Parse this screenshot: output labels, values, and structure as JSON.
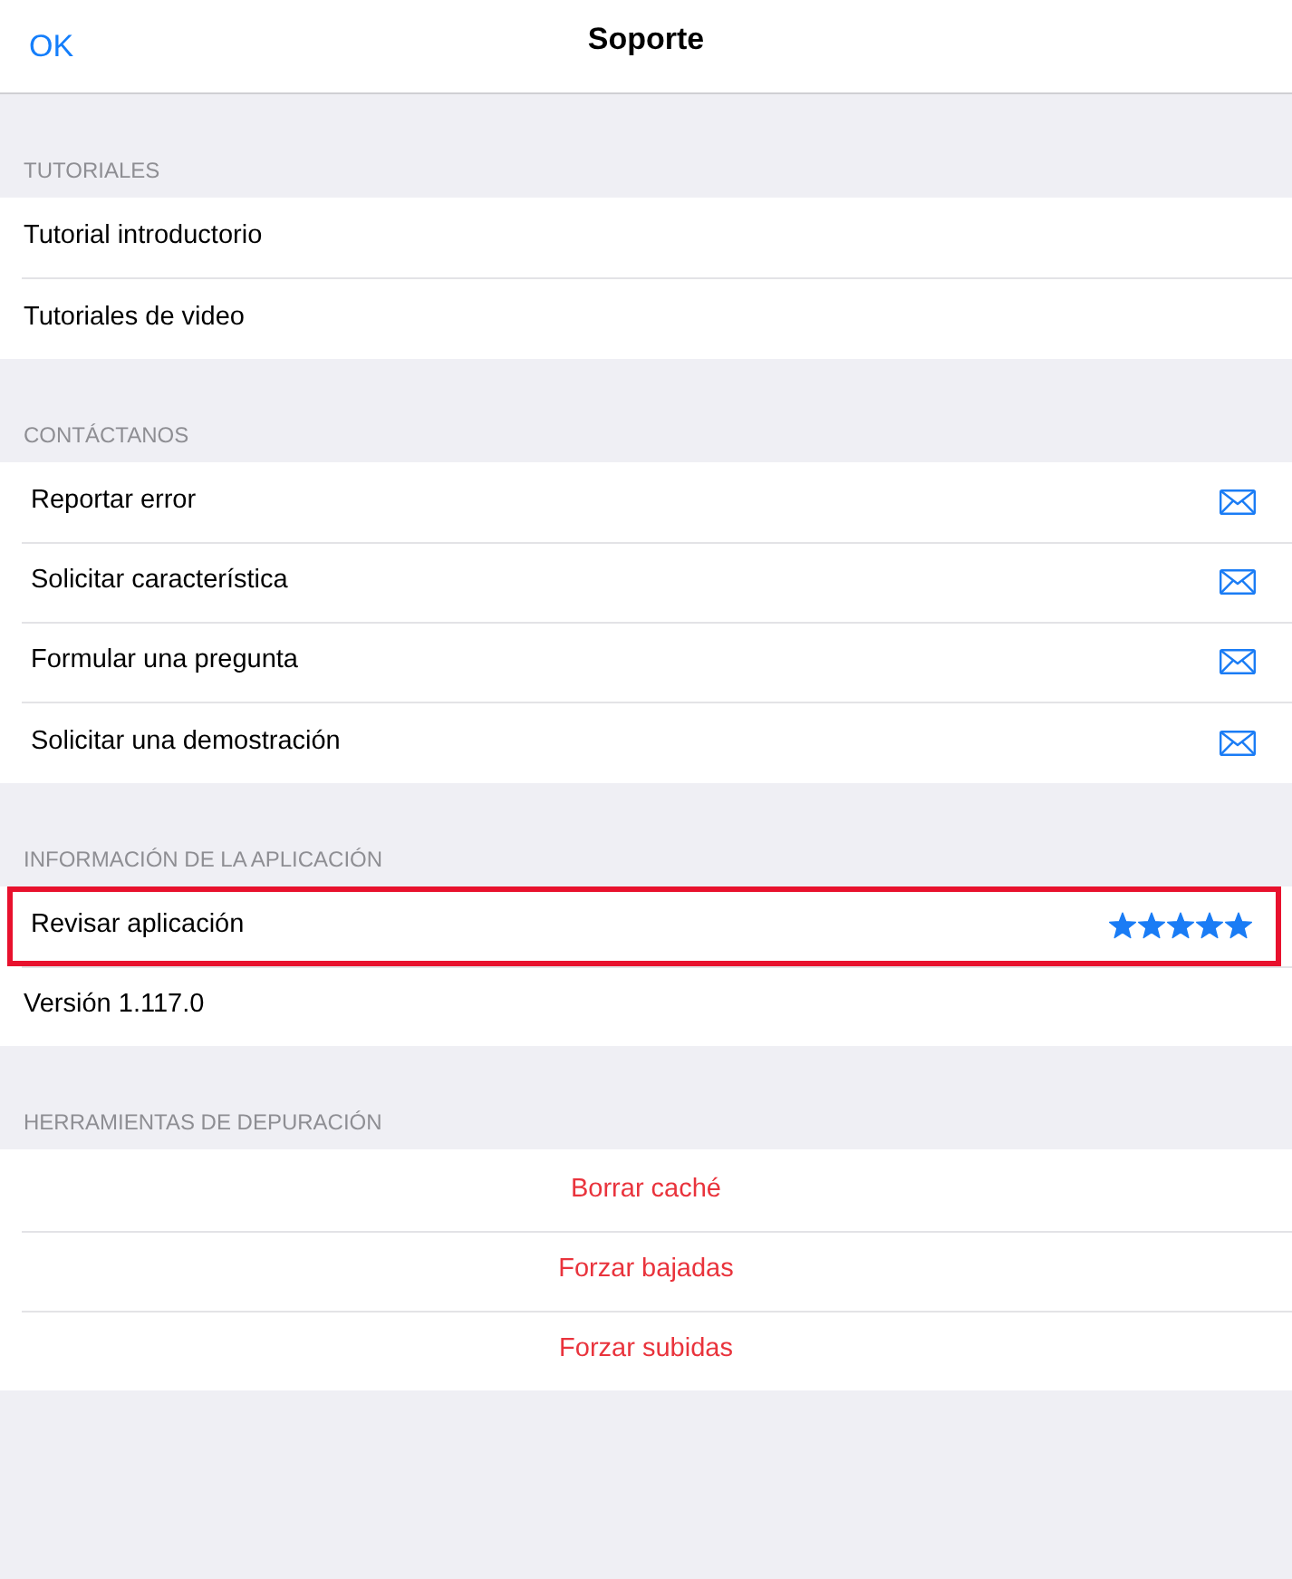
{
  "nav_bar": {
    "left_button": "OK",
    "title": "Soporte"
  },
  "sections": [
    {
      "header": "TUTORIALES",
      "items": [
        {
          "kind": "link",
          "label": "Tutorial introductorio",
          "highlighted": false
        },
        {
          "kind": "link",
          "label": "Tutoriales de video",
          "highlighted": false
        }
      ]
    },
    {
      "header": "CONTÁCTANOS",
      "items": [
        {
          "kind": "mail",
          "label": "Reportar error",
          "highlighted": false
        },
        {
          "kind": "mail",
          "label": "Solicitar característica",
          "highlighted": false
        },
        {
          "kind": "mail",
          "label": "Formular una pregunta",
          "highlighted": false
        },
        {
          "kind": "mail",
          "label": "Solicitar una demostración",
          "highlighted": false
        }
      ]
    },
    {
      "header": "INFORMACIÓN DE LA APLICACIÓN",
      "items": [
        {
          "kind": "rating",
          "label": "Revisar aplicación",
          "stars": 5,
          "highlighted": true
        },
        {
          "kind": "info",
          "label": "Versión 1.117.0",
          "highlighted": false
        }
      ]
    },
    {
      "header": "HERRAMIENTAS DE DEPURACIÓN",
      "items": [
        {
          "kind": "action",
          "label": "Borrar caché",
          "highlighted": false
        },
        {
          "kind": "action",
          "label": "Forzar bajadas",
          "highlighted": false
        },
        {
          "kind": "action",
          "label": "Forzar subidas",
          "highlighted": false
        }
      ]
    }
  ]
}
